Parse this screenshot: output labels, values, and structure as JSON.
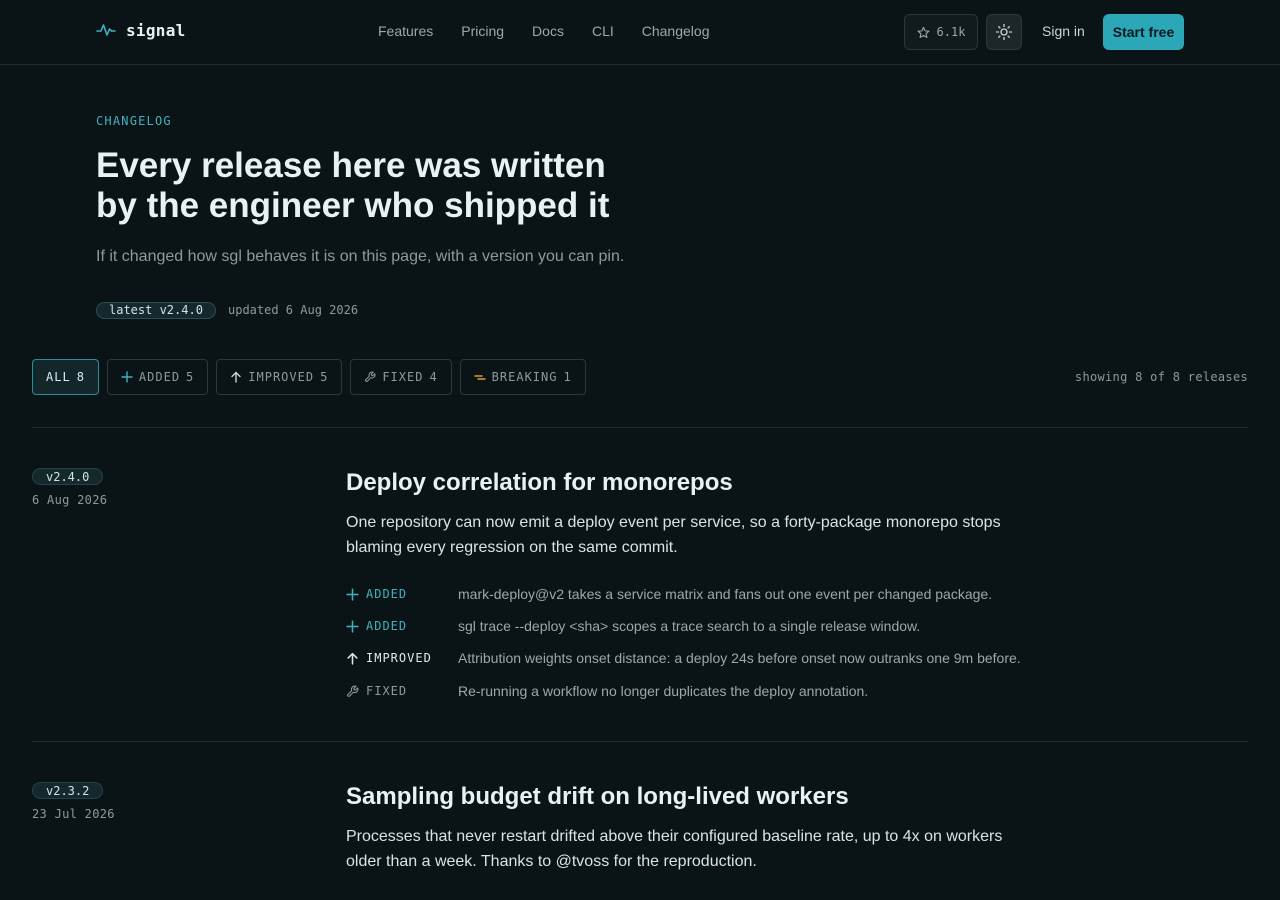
{
  "nav": {
    "brand": "signal",
    "links": [
      "Features",
      "Pricing",
      "Docs",
      "CLI",
      "Changelog"
    ],
    "stars": "6.1k",
    "signin": "Sign in",
    "cta": "Start free"
  },
  "hero": {
    "eyebrow": "CHANGELOG",
    "title": "Every release here was written by the engineer who shipped it",
    "subtitle": "If it changed how sgl behaves it is on this page, with a version you can pin.",
    "latest": "latest v2.4.0",
    "updated": "updated 6 Aug 2026"
  },
  "filters": [
    {
      "label": "ALL",
      "count": "8",
      "icon": "none",
      "active": true
    },
    {
      "label": "ADDED",
      "count": "5",
      "icon": "plus-icon"
    },
    {
      "label": "IMPROVED",
      "count": "5",
      "icon": "arrow-up-icon"
    },
    {
      "label": "FIXED",
      "count": "4",
      "icon": "wrench-icon"
    },
    {
      "label": "BREAKING",
      "count": "1",
      "icon": "breaking-icon"
    }
  ],
  "showing": "showing 8 of 8 releases",
  "colors": {
    "accent": "#2ba7b8",
    "background": "#0a1416",
    "breaking": "#e0a030"
  },
  "releases": [
    {
      "version": "v2.4.0",
      "date": "6 Aug 2026",
      "title": "Deploy correlation for monorepos",
      "description": "One repository can now emit a deploy event per service, so a forty-package monorepo stops blaming every regression on the same commit.",
      "changes": [
        {
          "type": "ADDED",
          "text": "mark-deploy@v2 takes a service matrix and fans out one event per changed package."
        },
        {
          "type": "ADDED",
          "text": "sgl trace --deploy <sha> scopes a trace search to a single release window."
        },
        {
          "type": "IMPROVED",
          "text": "Attribution weights onset distance: a deploy 24s before onset now outranks one 9m before."
        },
        {
          "type": "FIXED",
          "text": "Re-running a workflow no longer duplicates the deploy annotation."
        }
      ]
    },
    {
      "version": "v2.3.2",
      "date": "23 Jul 2026",
      "title": "Sampling budget drift on long-lived workers",
      "description": "Processes that never restart drifted above their configured baseline rate, up to 4x on workers older than a week. Thanks to @tvoss for the reproduction."
    }
  ]
}
